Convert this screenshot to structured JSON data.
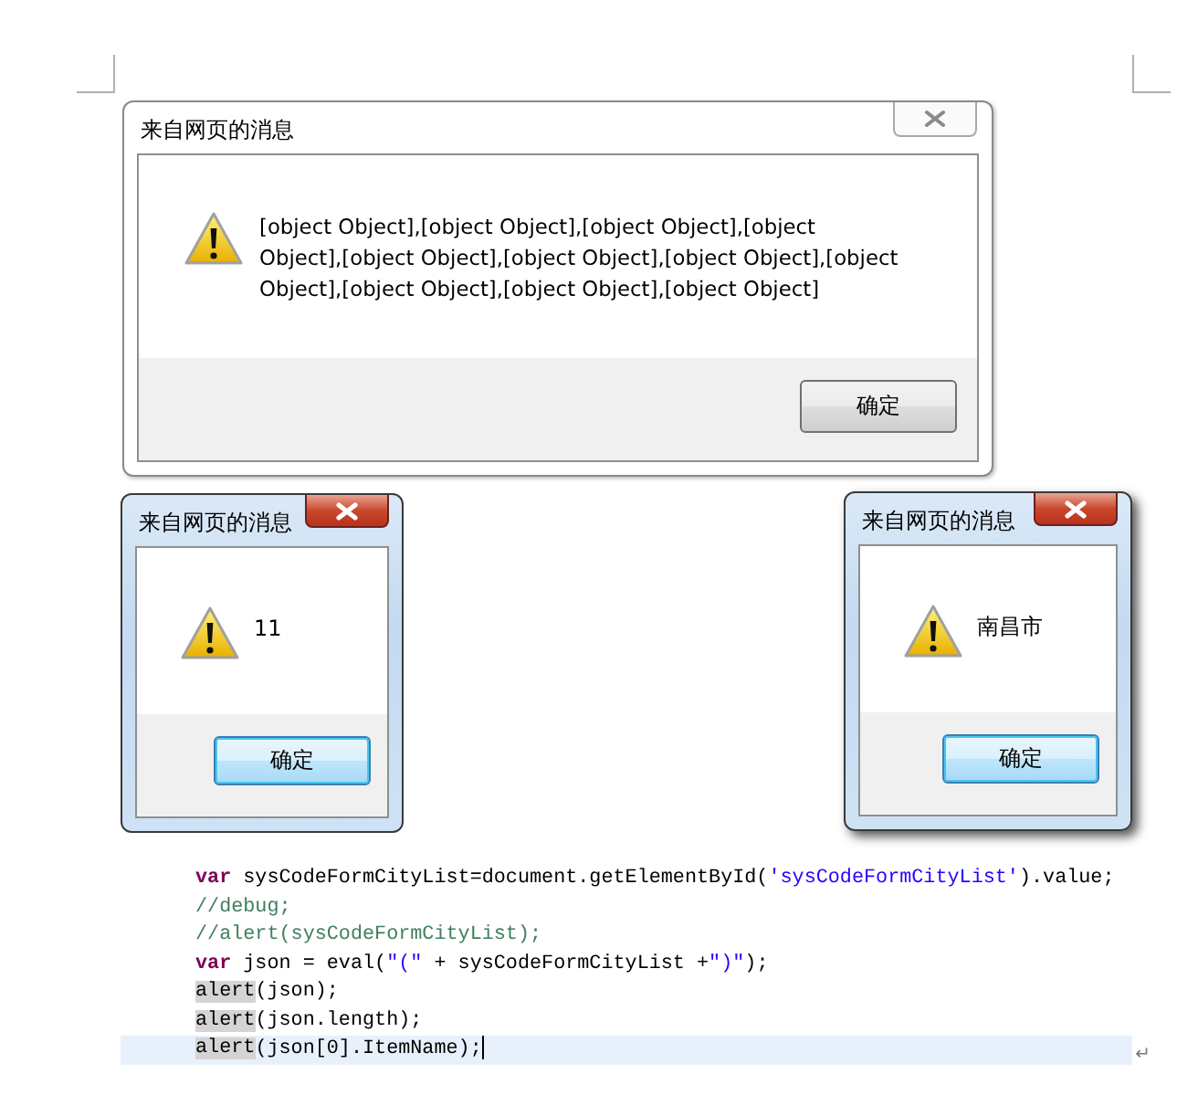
{
  "dialogs": [
    {
      "kind": "classic",
      "title": "来自网页的消息",
      "message": "[object Object],[object Object],[object Object],[object Object],[object Object],[object Object],[object Object],[object Object],[object Object],[object Object],[object Object]",
      "button": "确定"
    },
    {
      "kind": "aero",
      "title": "来自网页的消息",
      "message": "11",
      "button": "确定"
    },
    {
      "kind": "aero",
      "title": "来自网页的消息",
      "message": "南昌市",
      "button": "确定"
    }
  ],
  "code": {
    "lines": [
      {
        "current": false,
        "tokens": [
          {
            "kind": "keyword",
            "text": "var"
          },
          {
            "kind": "plain",
            "text": " sysCodeFormCityList=document.getElementById("
          },
          {
            "kind": "string",
            "text": "'sysCodeFormCityList'"
          },
          {
            "kind": "plain",
            "text": ").value;"
          }
        ]
      },
      {
        "current": false,
        "tokens": [
          {
            "kind": "comment",
            "text": "//debug;"
          }
        ]
      },
      {
        "current": false,
        "tokens": [
          {
            "kind": "comment",
            "text": "//alert(sysCodeFormCityList);"
          }
        ]
      },
      {
        "current": false,
        "tokens": [
          {
            "kind": "keyword",
            "text": "var"
          },
          {
            "kind": "plain",
            "text": " json = eval("
          },
          {
            "kind": "string",
            "text": "\"(\""
          },
          {
            "kind": "plain",
            "text": " + sysCodeFormCityList +"
          },
          {
            "kind": "string",
            "text": "\")\""
          },
          {
            "kind": "plain",
            "text": ");"
          }
        ]
      },
      {
        "current": false,
        "tokens": [
          {
            "kind": "highlight",
            "text": "alert"
          },
          {
            "kind": "plain",
            "text": "(json);"
          }
        ]
      },
      {
        "current": false,
        "tokens": [
          {
            "kind": "highlight",
            "text": "alert"
          },
          {
            "kind": "plain",
            "text": "(json.length);"
          }
        ]
      },
      {
        "current": true,
        "tokens": [
          {
            "kind": "highlight",
            "text": "alert"
          },
          {
            "kind": "plain",
            "text": "(json[0].ItemName);"
          }
        ]
      }
    ],
    "paragraph_mark": "↵"
  }
}
